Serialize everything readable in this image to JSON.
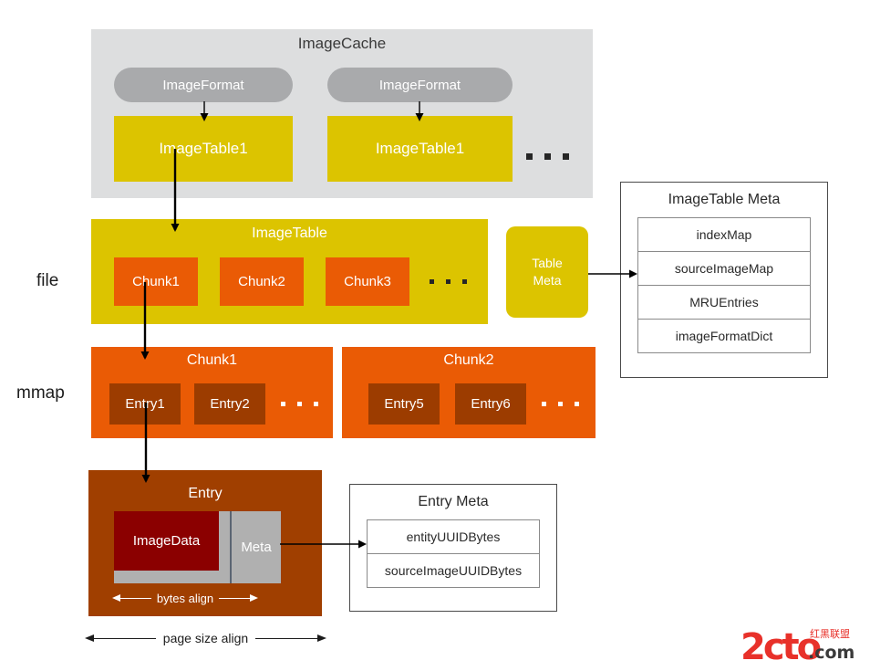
{
  "diagram": {
    "title": "ImageCache storage layout diagram",
    "colors": {
      "yellow": "#dcc400",
      "orange": "#ea5b05",
      "brown": "#9c3c00",
      "dark_red": "#8b0000",
      "gray_pill": "#a9aaac",
      "gray_bg": "#dddedf",
      "gray_slab": "#b0b0b0",
      "arrow": "#000000"
    }
  },
  "side_labels": {
    "file": "file",
    "mmap": "mmap"
  },
  "cache": {
    "title": "ImageCache",
    "formats": [
      {
        "label": "ImageFormat"
      },
      {
        "label": "ImageFormat"
      }
    ],
    "tables": [
      {
        "label": "ImageTable1"
      },
      {
        "label": "ImageTable1"
      }
    ],
    "ellipsis": "..."
  },
  "image_table": {
    "title": "ImageTable",
    "chunks": [
      {
        "label": "Chunk1"
      },
      {
        "label": "Chunk2"
      },
      {
        "label": "Chunk3"
      }
    ],
    "ellipsis": "..."
  },
  "table_meta": {
    "line1": "Table",
    "line2": "Meta"
  },
  "image_table_meta": {
    "title": "ImageTable Meta",
    "rows": [
      {
        "label": "indexMap"
      },
      {
        "label": "sourceImageMap"
      },
      {
        "label": "MRUEntries"
      },
      {
        "label": "imageFormatDict"
      }
    ]
  },
  "mmap_chunks": [
    {
      "title": "Chunk1",
      "entries": [
        {
          "label": "Entry1"
        },
        {
          "label": "Entry2"
        }
      ],
      "ellipsis": "..."
    },
    {
      "title": "Chunk2",
      "entries": [
        {
          "label": "Entry5"
        },
        {
          "label": "Entry6"
        }
      ],
      "ellipsis": "..."
    }
  ],
  "entry_detail": {
    "title": "Entry",
    "image_data_label": "ImageData",
    "meta_label": "Meta",
    "bytes_align_label": "bytes align"
  },
  "entry_meta": {
    "title": "Entry Meta",
    "rows": [
      {
        "label": "entityUUIDBytes"
      },
      {
        "label": "sourceImageUUIDBytes"
      }
    ]
  },
  "page_align": {
    "label": "page size align"
  },
  "watermark": {
    "brand": "2cto",
    "domain": ".com",
    "chinese": "红黑联盟"
  }
}
